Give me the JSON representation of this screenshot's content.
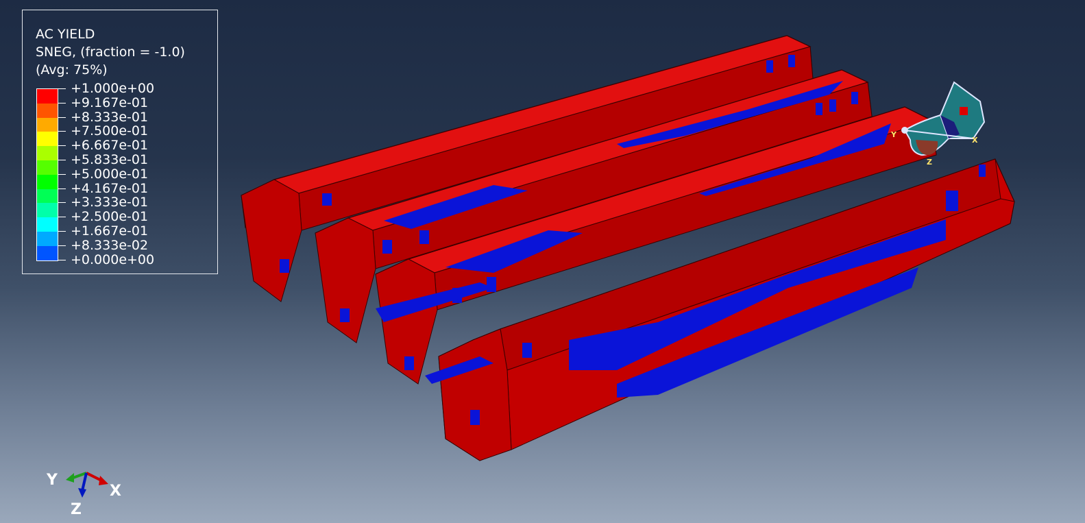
{
  "legend": {
    "title": "AC YIELD",
    "subtitle": "SNEG, (fraction = -1.0)",
    "averaging": "(Avg: 75%)",
    "values": [
      "+1.000e+00",
      "+9.167e-01",
      "+8.333e-01",
      "+7.500e-01",
      "+6.667e-01",
      "+5.833e-01",
      "+5.000e-01",
      "+4.167e-01",
      "+3.333e-01",
      "+2.500e-01",
      "+1.667e-01",
      "+8.333e-02",
      "+0.000e+00"
    ],
    "colors": [
      "#ff0000",
      "#ff5500",
      "#ffaa00",
      "#ffff00",
      "#aaff00",
      "#55ff00",
      "#00ff00",
      "#00ff55",
      "#00ffaa",
      "#00ffff",
      "#00aaff",
      "#0055ff",
      "#0000ff"
    ]
  },
  "triad": {
    "x_label": "X",
    "y_label": "Y",
    "z_label": "Z"
  },
  "view_widget": {
    "x_label": "X",
    "y_label": "Y",
    "z_label": "Z"
  },
  "colors": {
    "yield_full": "#dd0000",
    "yield_zero": "#0a14d8",
    "background_top": "#1d2b44",
    "background_bottom": "#9aa8bb"
  }
}
